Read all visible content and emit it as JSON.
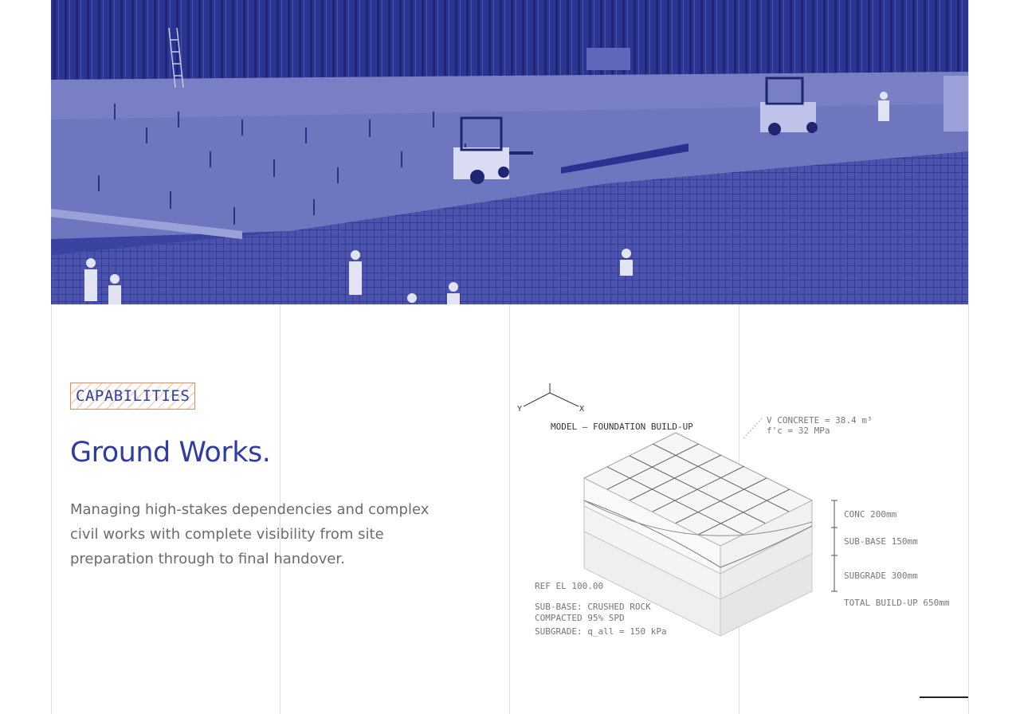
{
  "hero": {
    "image_alt": "Construction site with rebar grid, workers and forklifts",
    "tint": "#3a43a0"
  },
  "section": {
    "tag": "CAPABILITIES",
    "title": "Ground Works.",
    "lede": "Managing high-stakes dependencies and complex civil works with complete visibility from site preparation through to final handover."
  },
  "diagram": {
    "axis_y": "Y",
    "axis_x": "X",
    "model_title": "MODEL — FOUNDATION BUILD-UP",
    "volume_line1": "V CONCRETE = 38.4 m³",
    "volume_line2": "f'c = 32 MPa",
    "layer_conc": "CONC 200mm",
    "layer_subbase": "SUB-BASE 150mm",
    "layer_subgrade": "SUBGRADE 300mm",
    "total": "TOTAL BUILD-UP 650mm",
    "ref_el": "REF EL 100.00",
    "note_subbase_1": "SUB-BASE: CRUSHED ROCK",
    "note_subbase_2": "COMPACTED 95% SPD",
    "note_subgrade": "SUBGRADE: q_all = 150 kPa"
  },
  "colors": {
    "accent": "#2f3da3",
    "tag_border": "#e88a5a",
    "grid_line": "#dedee3"
  }
}
